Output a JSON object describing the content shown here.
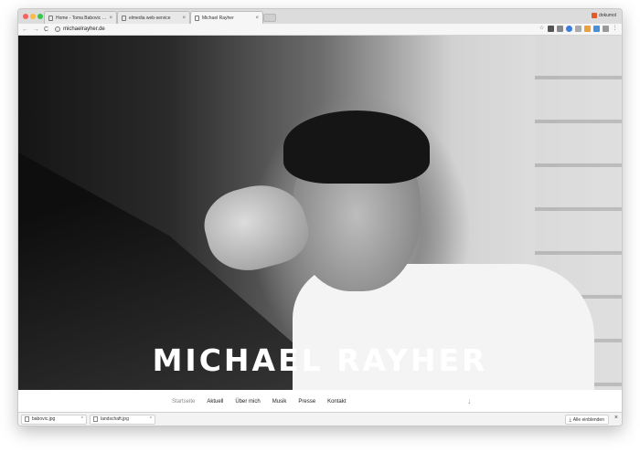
{
  "browser": {
    "tabs": [
      {
        "title": "Home - Toma Babovic | Photo",
        "close": "×"
      },
      {
        "title": "elmedia web-service",
        "close": "×"
      },
      {
        "title": "Michael Rayher",
        "close": "×"
      }
    ],
    "profile": "dokumol",
    "url": "michaelrayher.de",
    "nav": {
      "back": "←",
      "forward": "→",
      "reload": "C"
    }
  },
  "hero": {
    "title": "MICHAEL RAYHER"
  },
  "site_nav": {
    "items": [
      "Startseite",
      "Aktuell",
      "Über mich",
      "Musik",
      "Presse",
      "Kontakt"
    ],
    "scroll_arrow": "↓"
  },
  "downloads": {
    "items": [
      {
        "name": "babovic.jpg",
        "chevron": "^"
      },
      {
        "name": "landschaft.jpg",
        "chevron": "^"
      }
    ],
    "show_all": "Alle einblenden",
    "close": "×"
  }
}
